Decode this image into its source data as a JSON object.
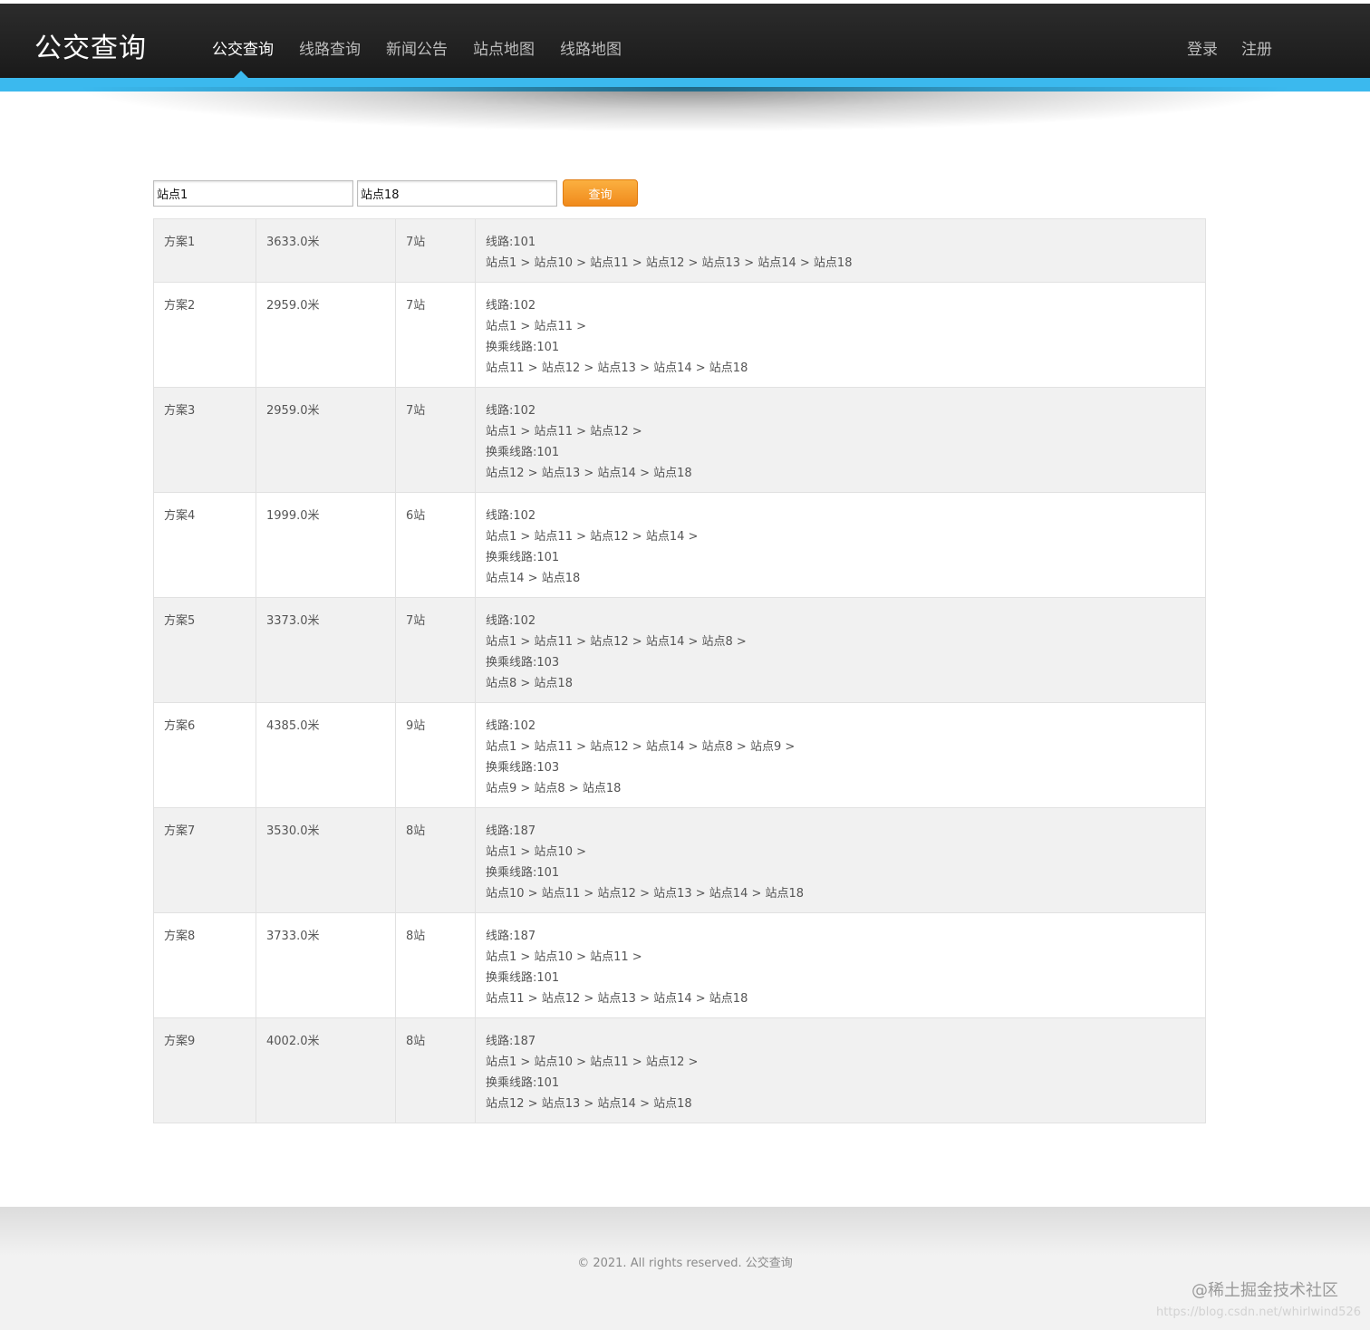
{
  "header": {
    "logo": "公交查询",
    "nav": [
      "公交查询",
      "线路查询",
      "新闻公告",
      "站点地图",
      "线路地图"
    ],
    "login": "登录",
    "register": "注册"
  },
  "search": {
    "from_value": "站点1",
    "to_value": "站点18",
    "button": "查询"
  },
  "results": [
    {
      "plan": "方案1",
      "distance": "3633.0米",
      "stops": "7站",
      "lines": [
        "线路:101",
        "站点1 > 站点10 > 站点11 > 站点12 > 站点13 > 站点14 > 站点18"
      ]
    },
    {
      "plan": "方案2",
      "distance": "2959.0米",
      "stops": "7站",
      "lines": [
        "线路:102",
        "站点1 > 站点11 >",
        "换乘线路:101",
        "站点11 > 站点12 > 站点13 > 站点14 > 站点18"
      ]
    },
    {
      "plan": "方案3",
      "distance": "2959.0米",
      "stops": "7站",
      "lines": [
        "线路:102",
        "站点1 > 站点11 > 站点12 >",
        "换乘线路:101",
        "站点12 > 站点13 > 站点14 > 站点18"
      ]
    },
    {
      "plan": "方案4",
      "distance": "1999.0米",
      "stops": "6站",
      "lines": [
        "线路:102",
        "站点1 > 站点11 > 站点12 > 站点14 >",
        "换乘线路:101",
        "站点14 > 站点18"
      ]
    },
    {
      "plan": "方案5",
      "distance": "3373.0米",
      "stops": "7站",
      "lines": [
        "线路:102",
        "站点1 > 站点11 > 站点12 > 站点14 > 站点8 >",
        "换乘线路:103",
        "站点8 > 站点18"
      ]
    },
    {
      "plan": "方案6",
      "distance": "4385.0米",
      "stops": "9站",
      "lines": [
        "线路:102",
        "站点1 > 站点11 > 站点12 > 站点14 > 站点8 > 站点9 >",
        "换乘线路:103",
        "站点9 > 站点8 > 站点18"
      ]
    },
    {
      "plan": "方案7",
      "distance": "3530.0米",
      "stops": "8站",
      "lines": [
        "线路:187",
        "站点1 > 站点10 >",
        "换乘线路:101",
        "站点10 > 站点11 > 站点12 > 站点13 > 站点14 > 站点18"
      ]
    },
    {
      "plan": "方案8",
      "distance": "3733.0米",
      "stops": "8站",
      "lines": [
        "线路:187",
        "站点1 > 站点10 > 站点11 >",
        "换乘线路:101",
        "站点11 > 站点12 > 站点13 > 站点14 > 站点18"
      ]
    },
    {
      "plan": "方案9",
      "distance": "4002.0米",
      "stops": "8站",
      "lines": [
        "线路:187",
        "站点1 > 站点10 > 站点11 > 站点12 >",
        "换乘线路:101",
        "站点12 > 站点13 > 站点14 > 站点18"
      ]
    }
  ],
  "footer": {
    "copyright": "© 2021. All rights reserved. 公交查询",
    "watermark": "@稀土掘金技术社区",
    "url_watermark": "https://blog.csdn.net/whirlwind526"
  },
  "colors": {
    "header_bg": "#222222",
    "accent_blue": "#3bb9ee",
    "button_orange": "#f39a26"
  }
}
